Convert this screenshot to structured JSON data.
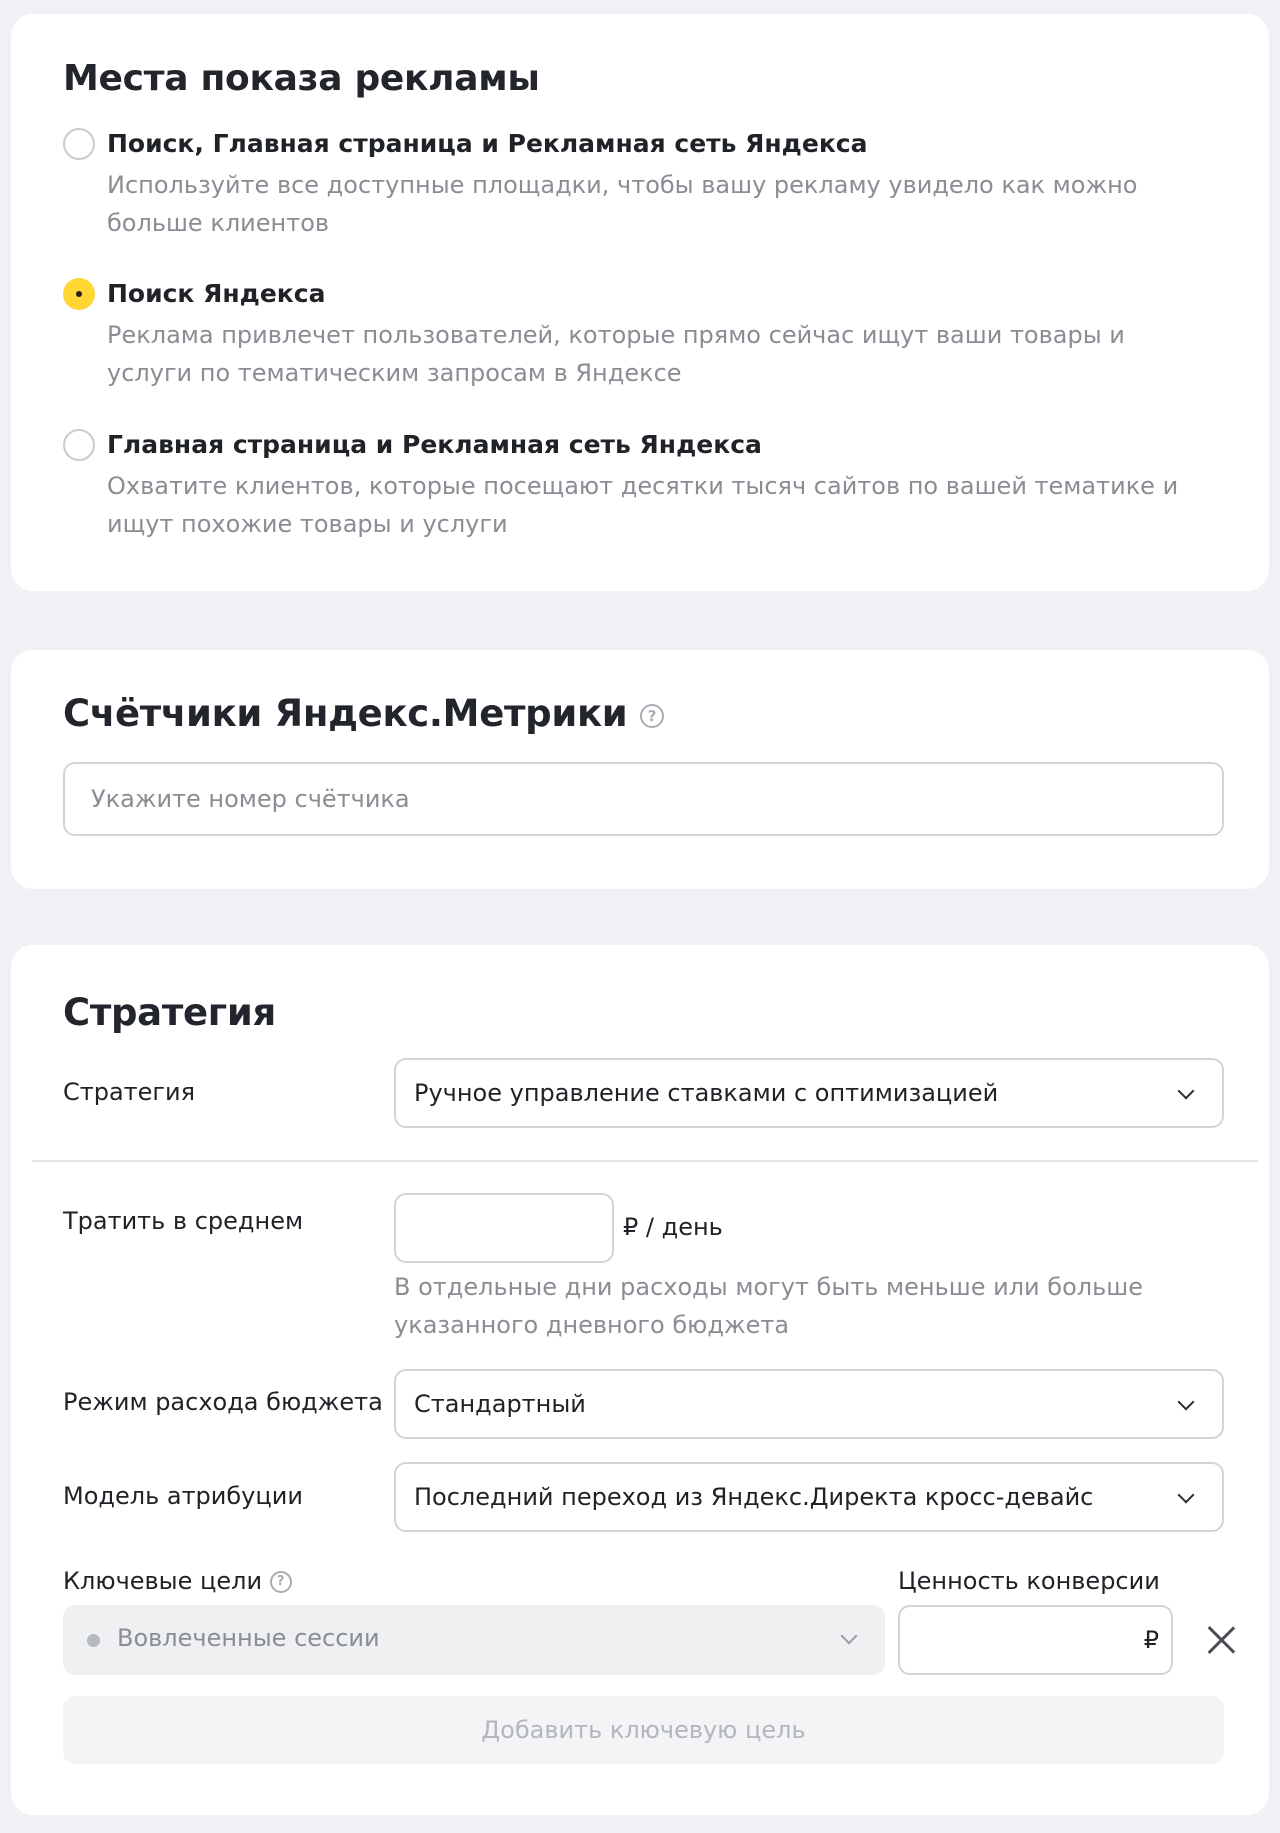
{
  "places": {
    "title": "Места показа рекламы",
    "options": [
      {
        "title": "Поиск, Главная страница и Рекламная сеть Яндекса",
        "description": "Используйте все доступные площадки, чтобы вашу рекламу увидело как можно больше клиентов",
        "selected": false
      },
      {
        "title": "Поиск Яндекса",
        "description": "Реклама привлечет пользователей, которые прямо сейчас ищут ваши товары и услуги по тематическим запросам в Яндексе",
        "selected": true
      },
      {
        "title": "Главная страница и Рекламная сеть Яндекса",
        "description": "Охватите клиентов, которые посещают десятки тысяч сайтов по вашей тематике и ищут похожие товары и услуги",
        "selected": false
      }
    ]
  },
  "metrika": {
    "title": "Счётчики Яндекс.Метрики",
    "help_icon": "?",
    "input_placeholder": "Укажите номер счётчика",
    "input_value": ""
  },
  "strategy": {
    "title": "Стратегия",
    "strategy_label": "Стратегия",
    "strategy_value": "Ручное управление ставками с оптимизацией",
    "spend_label": "Тратить в среднем",
    "spend_value": "",
    "spend_unit": "₽ / день",
    "spend_hint": "В отдельные дни расходы могут быть меньше или больше указанного дневного бюджета",
    "budget_mode_label": "Режим расхода бюджета",
    "budget_mode_value": "Стандартный",
    "attribution_label": "Модель атрибуции",
    "attribution_value": "Последний переход из Яндекс.Директа кросс-девайс",
    "key_goals_label": "Ключевые цели",
    "help_icon": "?",
    "conversion_value_label": "Ценность конверсии",
    "goal_value": "Вовлеченные сессии",
    "conversion_value": "",
    "currency": "₽",
    "add_goal_label": "Добавить ключевую цель"
  },
  "colors": {
    "accent": "#ffd633",
    "page_background": "#f0f1f4",
    "card_background": "#ffffff",
    "secondary_text": "#8a8d93"
  },
  "icons": [
    "help-circle-icon",
    "chevron-down-icon",
    "close-icon"
  ]
}
